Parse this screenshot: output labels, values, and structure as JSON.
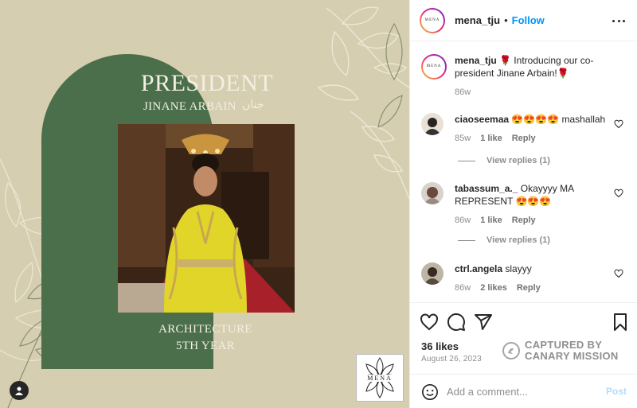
{
  "post": {
    "poster": {
      "title": "PRESIDENT",
      "name": "JINANE ARBAIN",
      "name_arabic": "جنان",
      "major_line1": "ARCHITECTURE",
      "major_line2": "5TH YEAR",
      "logo_text": "MENA"
    }
  },
  "header": {
    "username": "mena_tju",
    "separator": "•",
    "follow_label": "Follow",
    "avatar_text": "MENA"
  },
  "caption": {
    "username": "mena_tju",
    "text": "🌹 Introducing our co-president Jinane Arbain!🌹",
    "time": "86w"
  },
  "comments": [
    {
      "username": "ciaoseemaa",
      "text": "😍😍😍😍 mashallah",
      "time": "85w",
      "likes": "1 like",
      "reply_label": "Reply",
      "view_replies": "View replies (1)"
    },
    {
      "username": "tabassum_a._",
      "text": "Okayyyy MA REPRESENT 😍😍😍",
      "time": "86w",
      "likes": "1 like",
      "reply_label": "Reply",
      "view_replies": "View replies (1)"
    },
    {
      "username": "ctrl.angela",
      "text": "slayyy",
      "time": "86w",
      "likes": "2 likes",
      "reply_label": "Reply"
    }
  ],
  "actions": {
    "likes_count": "36 likes",
    "date": "August 26, 2023"
  },
  "watermark": {
    "line1": "CAPTURED BY",
    "line2": "CANARY MISSION"
  },
  "add_comment": {
    "placeholder": "Add a comment...",
    "post_label": "Post"
  },
  "colors": {
    "background_beige": "#d6ceb0",
    "arch_green": "#4b6f4a",
    "link_blue": "#0095f6",
    "post_disabled": "#b3dbff"
  }
}
